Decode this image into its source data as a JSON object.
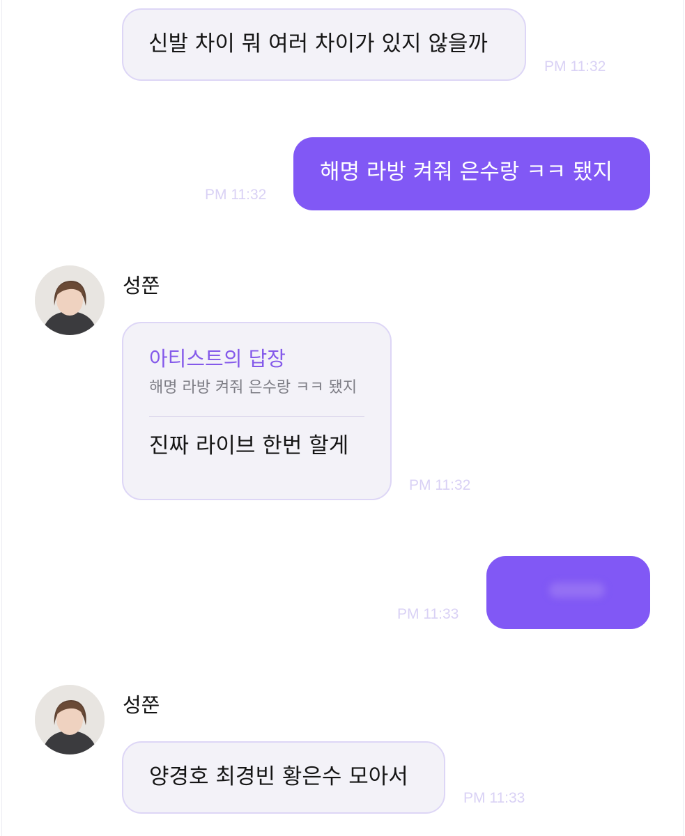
{
  "messages": [
    {
      "direction": "incoming",
      "text": "신발 차이 뭐 여러 차이가 있지 않을까",
      "time": "PM 11:32"
    },
    {
      "direction": "outgoing",
      "text": "해명 라방 켜줘 은수랑 ㅋㅋ 됐지",
      "time": "PM 11:32"
    },
    {
      "direction": "incoming",
      "sender": "성쭌",
      "avatar_icon": "profile-photo",
      "reply": {
        "label": "아티스트의 답장",
        "quoted": "해명 라방 켜줘 은수랑 ㅋㅋ 됐지",
        "text": "진짜 라이브 한번 할게"
      },
      "time": "PM 11:32"
    },
    {
      "direction": "outgoing",
      "text": "",
      "content_hidden": true,
      "time": "PM 11:33"
    },
    {
      "direction": "incoming",
      "sender": "성쭌",
      "avatar_icon": "profile-photo",
      "text": "양경호 최경빈 황은수 모아서",
      "time": "PM 11:33"
    }
  ],
  "colors": {
    "outgoing_bubble": "#8158f5",
    "incoming_bubble": "#f3f2f8",
    "incoming_border": "#ddd6f6",
    "timestamp": "#d9d1f5",
    "reply_label": "#8459ea"
  }
}
